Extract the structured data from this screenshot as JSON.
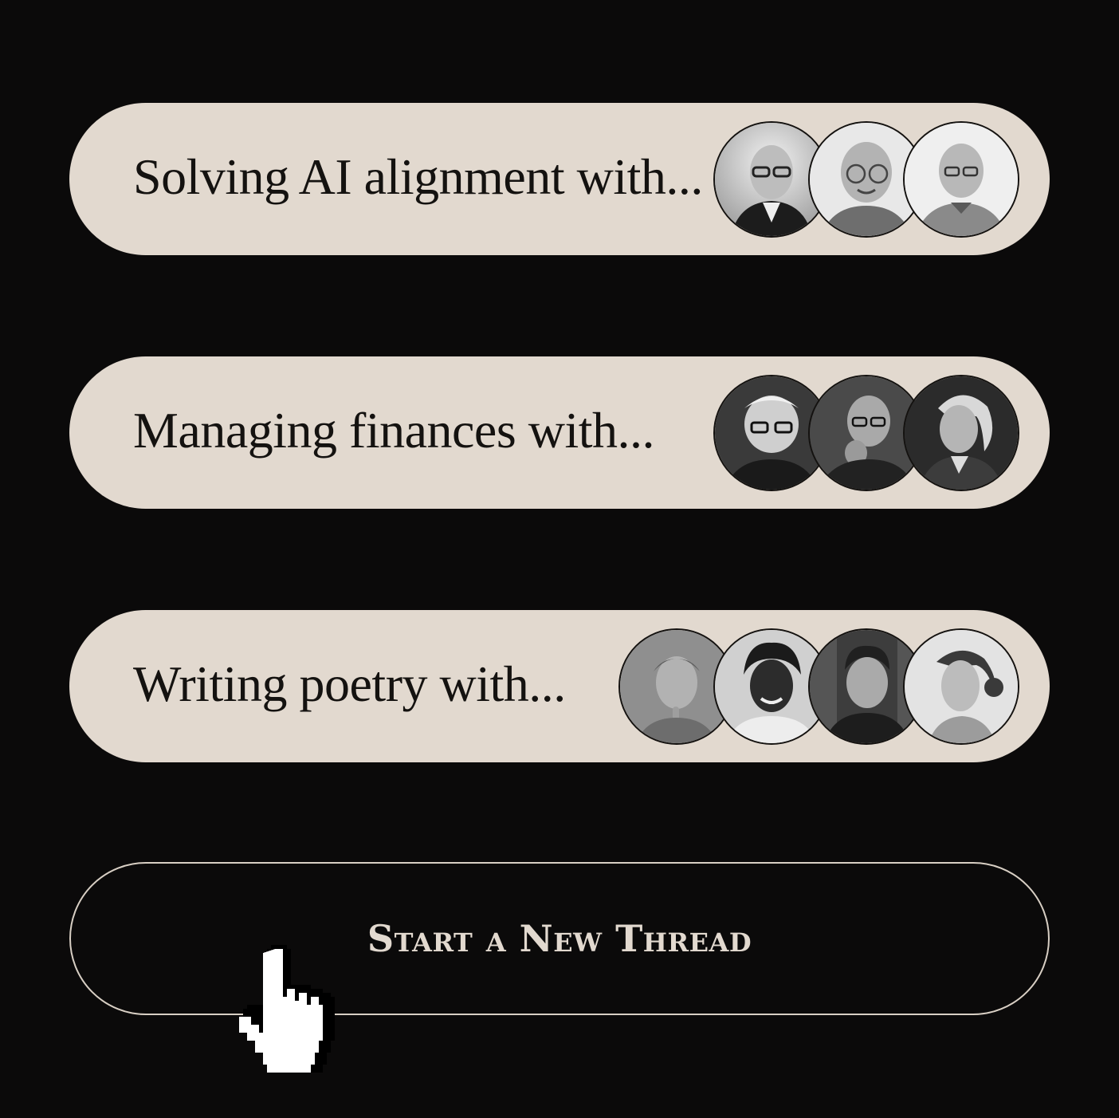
{
  "colors": {
    "background": "#0b0a0a",
    "pill_background": "#e2d9cf",
    "text_dark": "#141210",
    "cta_border": "#d8cfc4",
    "cta_text": "#e2d9cf"
  },
  "topics": [
    {
      "label": "Solving AI alignment with...",
      "avatars": [
        "portrait-icon",
        "portrait-icon",
        "portrait-icon"
      ]
    },
    {
      "label": "Managing finances with...",
      "avatars": [
        "portrait-icon",
        "portrait-icon",
        "portrait-icon"
      ]
    },
    {
      "label": "Writing poetry with...",
      "avatars": [
        "portrait-icon",
        "portrait-icon",
        "portrait-icon",
        "portrait-icon"
      ]
    }
  ],
  "cta": {
    "label": "Start a New Thread"
  },
  "cursor": {
    "icon": "hand-pointer-icon"
  }
}
